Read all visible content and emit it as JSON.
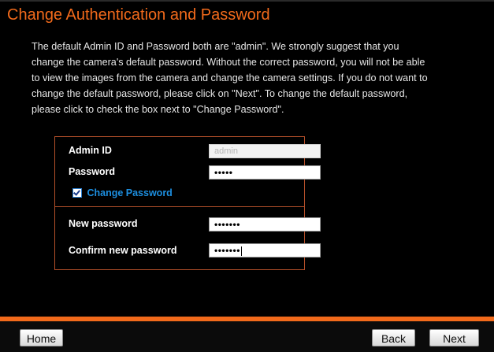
{
  "page": {
    "title": "Change Authentication and Password",
    "intro_lines": [
      "The default Admin ID and Password both are \"admin\". We strongly suggest that you",
      "change the camera's default password. Without the correct password, you will not be able",
      "to view the images from the camera and change the camera settings. If you do not want to",
      "change the default password, please click on \"Next\". To change the default password,",
      "please click to check the box next to \"Change Password\"."
    ]
  },
  "form": {
    "admin_id_label": "Admin ID",
    "admin_id_value": "admin",
    "password_label": "Password",
    "password_value": "•••••",
    "change_password_label": "Change Password",
    "change_password_checked": true,
    "new_password_label": "New password",
    "new_password_value": "•••••••",
    "confirm_password_label": "Confirm new password",
    "confirm_password_value": "•••••••"
  },
  "footer": {
    "home_label": "Home",
    "back_label": "Back",
    "next_label": "Next"
  },
  "colors": {
    "accent": "#f26a1b",
    "link_blue": "#1d8fe0",
    "box_border": "#b5502a"
  }
}
